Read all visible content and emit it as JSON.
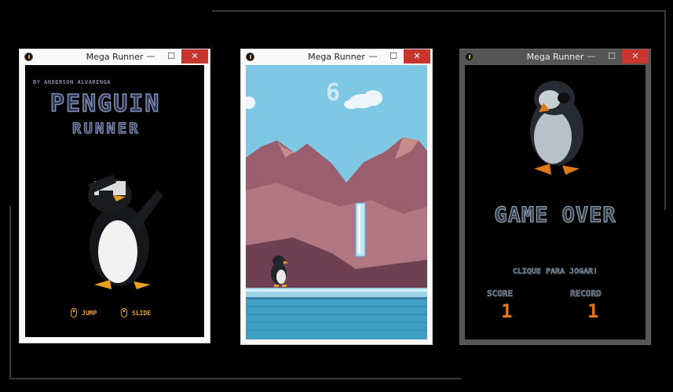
{
  "windows": [
    {
      "title": "Mega Runner",
      "btn_min": "—",
      "btn_max": "☐",
      "btn_close": "✕"
    },
    {
      "title": "Mega Runner",
      "btn_min": "—",
      "btn_max": "☐",
      "btn_close": "✕"
    },
    {
      "title": "Mega Runner",
      "btn_min": "—",
      "btn_max": "☐",
      "btn_close": "✕"
    }
  ],
  "menu": {
    "author": "BY ANDERSON ALVARENGA",
    "logo_line1": "PENGUIN",
    "logo_line2": "RUNNER",
    "controls": [
      {
        "icon": "mouse-left-icon",
        "label": "JUMP"
      },
      {
        "icon": "mouse-right-icon",
        "label": "SLIDE"
      }
    ]
  },
  "gameplay": {
    "score": "6"
  },
  "gameover": {
    "title": "GAME OVER",
    "prompt": "CLIQUE PARA JOGAR!",
    "score_label": "SCORE",
    "score_value": "1",
    "record_label": "RECORD",
    "record_value": "1"
  },
  "colors": {
    "accent_orange": "#e8a020",
    "sky": "#7ec8e6",
    "mountain": "#9a5e6e",
    "water": "#3fa0c4",
    "close_button": "#c7352d"
  }
}
